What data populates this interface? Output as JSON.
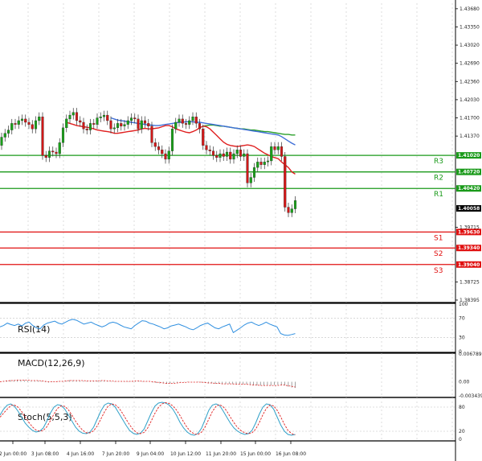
{
  "chart_data": [
    {
      "type": "candlestick",
      "price_ticks": [
        "1.43680",
        "1.43350",
        "1.43020",
        "1.42690",
        "1.42360",
        "1.42030",
        "1.41700",
        "1.41370",
        "1.41020",
        "1.40720",
        "1.40420",
        "1.40058",
        "1.39715",
        "1.39630",
        "1.39340",
        "1.39040",
        "1.38725",
        "1.38395"
      ],
      "ylim": [
        1.3838,
        1.4378
      ],
      "x_tick_labels": [
        "2 Jun 00:00",
        "3 Jun 08:00",
        "4 Jun 16:00",
        "7 Jun 20:00",
        "9 Jun 04:00",
        "10 Jun 12:00",
        "11 Jun 20:00",
        "15 Jun 00:00",
        "16 Jun 08:00"
      ],
      "current_price": "1.40058",
      "levels": [
        {
          "name": "R3",
          "price": 1.4102,
          "label": "1.41020",
          "color": "#1a9a1a"
        },
        {
          "name": "R2",
          "price": 1.4072,
          "label": "1.40720",
          "color": "#1a9a1a"
        },
        {
          "name": "R1",
          "price": 1.4042,
          "label": "1.40420",
          "color": "#1a9a1a"
        },
        {
          "name": "S1",
          "price": 1.3963,
          "label": "1.39630",
          "color": "#e01010"
        },
        {
          "name": "S2",
          "price": 1.3934,
          "label": "1.39340",
          "color": "#e01010"
        },
        {
          "name": "S3",
          "price": 1.3904,
          "label": "1.39040",
          "color": "#e01010"
        }
      ],
      "candles_close": [
        1.4135,
        1.4142,
        1.4148,
        1.416,
        1.4158,
        1.4165,
        1.4168,
        1.4162,
        1.4158,
        1.415,
        1.4165,
        1.4172,
        1.4102,
        1.4098,
        1.411,
        1.4108,
        1.4105,
        1.4125,
        1.4152,
        1.4168,
        1.4175,
        1.418,
        1.4165,
        1.4162,
        1.415,
        1.4148,
        1.416,
        1.4158,
        1.417,
        1.4172,
        1.4175,
        1.4165,
        1.415,
        1.4152,
        1.416,
        1.4155,
        1.4158,
        1.4165,
        1.417,
        1.4168,
        1.415,
        1.4165,
        1.416,
        1.4155,
        1.4125,
        1.4118,
        1.4112,
        1.4105,
        1.4095,
        1.411,
        1.415,
        1.4162,
        1.4168,
        1.416,
        1.4158,
        1.4165,
        1.4172,
        1.416,
        1.415,
        1.412,
        1.4112,
        1.411,
        1.4102,
        1.4098,
        1.4105,
        1.41,
        1.4108,
        1.4095,
        1.4105,
        1.4112,
        1.41,
        1.4105,
        1.4052,
        1.4062,
        1.408,
        1.409,
        1.4085,
        1.409,
        1.4092,
        1.4118,
        1.4112,
        1.4118,
        1.41,
        1.4008,
        1.3998,
        1.4005,
        1.402
      ],
      "candles_open": [
        1.412,
        1.4135,
        1.4142,
        1.4148,
        1.416,
        1.4158,
        1.4165,
        1.4168,
        1.4162,
        1.4158,
        1.415,
        1.4165,
        1.4172,
        1.4102,
        1.4098,
        1.411,
        1.4108,
        1.4105,
        1.4125,
        1.4152,
        1.4168,
        1.4175,
        1.418,
        1.4165,
        1.4162,
        1.415,
        1.4148,
        1.416,
        1.4158,
        1.417,
        1.4172,
        1.4175,
        1.4165,
        1.415,
        1.4152,
        1.416,
        1.4155,
        1.4158,
        1.4165,
        1.417,
        1.4168,
        1.415,
        1.4165,
        1.416,
        1.4155,
        1.4125,
        1.4118,
        1.4112,
        1.4105,
        1.4095,
        1.411,
        1.415,
        1.4162,
        1.4168,
        1.416,
        1.4158,
        1.4165,
        1.4172,
        1.416,
        1.415,
        1.412,
        1.4112,
        1.411,
        1.4102,
        1.4098,
        1.4105,
        1.41,
        1.4108,
        1.4095,
        1.4105,
        1.4112,
        1.41,
        1.4105,
        1.4052,
        1.4062,
        1.408,
        1.409,
        1.4085,
        1.409,
        1.4092,
        1.4118,
        1.4112,
        1.4118,
        1.41,
        1.4008,
        1.3998,
        1.4005
      ],
      "ma_fast": [
        1.4162,
        1.416,
        1.4158,
        1.4156,
        1.4155,
        1.4154,
        1.4153,
        1.4152,
        1.415,
        1.4148,
        1.4147,
        1.4146,
        1.4145,
        1.4144,
        1.4142,
        1.4142,
        1.4143,
        1.4144,
        1.4145,
        1.4146,
        1.4147,
        1.4148,
        1.415,
        1.4151,
        1.415,
        1.415,
        1.4151,
        1.4152,
        1.4154,
        1.4156,
        1.4156,
        1.4154,
        1.415,
        1.4148,
        1.4146,
        1.4144,
        1.4143,
        1.4145,
        1.4148,
        1.4152,
        1.4155,
        1.4154,
        1.415,
        1.4144,
        1.4138,
        1.4132,
        1.4126,
        1.4122,
        1.412,
        1.4119,
        1.4118,
        1.4119,
        1.412,
        1.4121,
        1.412,
        1.4118,
        1.4114,
        1.411,
        1.4106,
        1.4103,
        1.41,
        1.4098,
        1.4096,
        1.409,
        1.4085,
        1.408,
        1.4072,
        1.4068
      ],
      "ma_mid": [
        1.417,
        1.4168,
        1.4166,
        1.4165,
        1.4164,
        1.4163,
        1.4162,
        1.4161,
        1.416,
        1.4159,
        1.4158,
        1.4157,
        1.4157,
        1.4156,
        1.4156,
        1.4157,
        1.4158,
        1.4159,
        1.416,
        1.4161,
        1.4162,
        1.4162,
        1.4163,
        1.4163,
        1.4163,
        1.4162,
        1.4162,
        1.4161,
        1.416,
        1.4159,
        1.4158,
        1.4157,
        1.4156,
        1.4155,
        1.4154,
        1.4153,
        1.4152,
        1.4151,
        1.415,
        1.4149,
        1.4148,
        1.4147,
        1.4146,
        1.4145,
        1.4144,
        1.4143,
        1.4142,
        1.4141,
        1.414,
        1.4139,
        1.4136,
        1.4132,
        1.4128,
        1.4124,
        1.4121
      ],
      "ma_slow": [
        1.4155,
        1.4156,
        1.4157,
        1.4157,
        1.4156,
        1.4155,
        1.4155,
        1.4154,
        1.4153,
        1.4152,
        1.4151,
        1.415,
        1.415,
        1.4149,
        1.4148,
        1.4148,
        1.4147,
        1.4146,
        1.4145,
        1.4145,
        1.4144,
        1.4143,
        1.4142,
        1.4141,
        1.414,
        1.414,
        1.4139,
        1.4139
      ],
      "last_shown_at_index": 86
    },
    {
      "type": "line",
      "name_label": "RSI(14)",
      "ticks": [
        "100",
        "70",
        "30",
        "0"
      ],
      "ylim": [
        0,
        100
      ],
      "values": [
        52,
        55,
        60,
        57,
        55,
        58,
        54,
        60,
        62,
        55,
        50,
        48,
        56,
        60,
        62,
        64,
        60,
        58,
        62,
        66,
        68,
        66,
        62,
        58,
        60,
        62,
        58,
        55,
        52,
        55,
        60,
        62,
        60,
        56,
        52,
        50,
        48,
        55,
        60,
        65,
        64,
        60,
        58,
        55,
        52,
        48,
        50,
        54,
        56,
        58,
        55,
        52,
        48,
        46,
        50,
        55,
        58,
        60,
        55,
        50,
        48,
        52,
        55,
        58,
        40,
        45,
        50,
        56,
        60,
        62,
        58,
        55,
        58,
        62,
        58,
        55,
        52,
        38,
        35,
        34,
        36,
        38
      ]
    },
    {
      "type": "bar",
      "name_label": "MACD(12,26,9)",
      "ticks": [
        "0.006789",
        "0.00",
        "-0.003439"
      ],
      "ylim": [
        -0.003439,
        0.006789
      ],
      "values": [
        0.0,
        0.0002,
        0.0003,
        0.0004,
        0.0004,
        0.0005,
        0.0004,
        0.0004,
        0.0003,
        0.0002,
        0.0002,
        0.0003,
        0.0002,
        -0.0001,
        -0.0002,
        -0.0001,
        0.0,
        0.0001,
        0.0002,
        0.0003,
        0.0004,
        0.0004,
        0.0003,
        0.0003,
        0.0002,
        0.0002,
        0.0002,
        0.0002,
        0.0003,
        0.0003,
        0.0003,
        0.0002,
        0.0001,
        0.0001,
        0.0001,
        0.0001,
        0.0001,
        0.0001,
        0.0002,
        0.0002,
        0.0002,
        0.0001,
        0.0001,
        0.0,
        -0.0002,
        -0.0003,
        -0.0004,
        -0.0004,
        -0.0005,
        -0.0004,
        -0.0003,
        -0.0002,
        -0.0001,
        -0.0001,
        -0.0001,
        0.0,
        0.0,
        -0.0001,
        -0.0002,
        -0.0003,
        -0.0004,
        -0.0004,
        -0.0005,
        -0.0005,
        -0.0005,
        -0.0005,
        -0.0005,
        -0.0006,
        -0.0006,
        -0.0006,
        -0.0006,
        -0.0006,
        -0.0008,
        -0.0009,
        -0.0009,
        -0.0009,
        -0.0009,
        -0.0009,
        -0.0009,
        -0.0008,
        -0.0008,
        -0.0008,
        -0.0009,
        -0.0012,
        -0.0014,
        -0.0015
      ],
      "signal": [
        0.0,
        0.0001,
        0.0002,
        0.0003,
        0.0003,
        0.0004,
        0.0004,
        0.0004,
        0.0004,
        0.0003,
        0.0003,
        0.0003,
        0.0002,
        0.0001,
        0.0,
        0.0,
        0.0,
        0.0001,
        0.0001,
        0.0002,
        0.0003,
        0.0003,
        0.0003,
        0.0003,
        0.0003,
        0.0002,
        0.0002,
        0.0002,
        0.0002,
        0.0003,
        0.0003,
        0.0002,
        0.0002,
        0.0001,
        0.0001,
        0.0001,
        0.0001,
        0.0001,
        0.0001,
        0.0002,
        0.0002,
        0.0001,
        0.0001,
        0.0001,
        0.0,
        -0.0001,
        -0.0002,
        -0.0003,
        -0.0004,
        -0.0004,
        -0.0004,
        -0.0003,
        -0.0002,
        -0.0002,
        -0.0001,
        -0.0001,
        -0.0001,
        -0.0001,
        -0.0001,
        -0.0002,
        -0.0003,
        -0.0003,
        -0.0004,
        -0.0004,
        -0.0005,
        -0.0005,
        -0.0005,
        -0.0005,
        -0.0006,
        -0.0006,
        -0.0006,
        -0.0006,
        -0.0007,
        -0.0008,
        -0.0008,
        -0.0009,
        -0.0009,
        -0.0009,
        -0.0009,
        -0.0009,
        -0.0009,
        -0.0008,
        -0.0008,
        -0.001,
        -0.0011,
        -0.0013
      ]
    },
    {
      "type": "line",
      "name_label": "Stoch(5,5,3)",
      "ticks": [
        "80",
        "20",
        "0"
      ],
      "ylim": [
        0,
        100
      ],
      "k": [
        60,
        75,
        85,
        88,
        82,
        70,
        55,
        40,
        30,
        22,
        18,
        20,
        28,
        45,
        65,
        80,
        86,
        84,
        75,
        60,
        45,
        30,
        20,
        15,
        14,
        18,
        30,
        50,
        70,
        85,
        90,
        88,
        80,
        65,
        50,
        35,
        22,
        15,
        12,
        15,
        25,
        45,
        65,
        82,
        90,
        92,
        90,
        85,
        75,
        60,
        42,
        28,
        18,
        12,
        10,
        15,
        28,
        50,
        72,
        85,
        88,
        84,
        70,
        55,
        40,
        28,
        20,
        15,
        12,
        14,
        22,
        40,
        62,
        80,
        88,
        86,
        75,
        55,
        35,
        20,
        12,
        10,
        12
      ],
      "d": [
        55,
        65,
        75,
        84,
        85,
        80,
        69,
        55,
        42,
        31,
        23,
        20,
        22,
        31,
        46,
        63,
        77,
        83,
        82,
        73,
        60,
        45,
        32,
        22,
        16,
        16,
        21,
        33,
        50,
        68,
        82,
        88,
        86,
        78,
        65,
        50,
        36,
        24,
        16,
        14,
        17,
        28,
        45,
        64,
        79,
        88,
        91,
        89,
        83,
        73,
        59,
        43,
        29,
        19,
        13,
        12,
        18,
        31,
        50,
        69,
        82,
        86,
        81,
        70,
        55,
        41,
        29,
        21,
        16,
        14,
        16,
        25,
        41,
        61,
        77,
        85,
        83,
        72,
        55,
        37,
        22,
        14,
        11
      ]
    }
  ]
}
